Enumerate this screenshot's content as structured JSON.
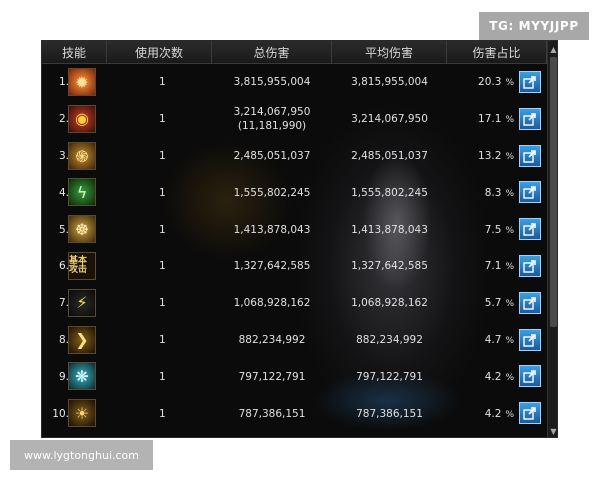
{
  "badge": "TG: MYYJJPP",
  "watermark": "www.lygtonghui.com",
  "colors": {
    "panel_bg": "#0b0b0b",
    "header_text": "#d8d8d8",
    "button_blue": "#2a7fc0"
  },
  "table": {
    "headers": [
      "技能",
      "使用次数",
      "总伤害",
      "平均伤害",
      "伤害占比"
    ],
    "rows": [
      {
        "rank": "1.",
        "icon": "flame-skill-icon",
        "uses": "1",
        "total": "3,815,955,004",
        "total_sub": "",
        "avg": "3,815,955,004",
        "pct": "20.3",
        "pct_sym": "%"
      },
      {
        "rank": "2.",
        "icon": "eye-skill-icon",
        "uses": "1",
        "total": "3,214,067,950",
        "total_sub": "(11,181,990)",
        "avg": "3,214,067,950",
        "pct": "17.1",
        "pct_sym": "%"
      },
      {
        "rank": "3.",
        "icon": "swirl-skill-icon",
        "uses": "1",
        "total": "2,485,051,037",
        "total_sub": "",
        "avg": "2,485,051,037",
        "pct": "13.2",
        "pct_sym": "%"
      },
      {
        "rank": "4.",
        "icon": "lightning-skill-icon",
        "uses": "1",
        "total": "1,555,802,245",
        "total_sub": "",
        "avg": "1,555,802,245",
        "pct": "8.3",
        "pct_sym": "%"
      },
      {
        "rank": "5.",
        "icon": "gear-skill-icon",
        "uses": "1",
        "total": "1,413,878,043",
        "total_sub": "",
        "avg": "1,413,878,043",
        "pct": "7.5",
        "pct_sym": "%"
      },
      {
        "rank": "6.",
        "icon": "basic-attack-icon",
        "icon_text": "基本攻击",
        "uses": "1",
        "total": "1,327,642,585",
        "total_sub": "",
        "avg": "1,327,642,585",
        "pct": "7.1",
        "pct_sym": "%"
      },
      {
        "rank": "7.",
        "icon": "bolt-skill-icon",
        "uses": "1",
        "total": "1,068,928,162",
        "total_sub": "",
        "avg": "1,068,928,162",
        "pct": "5.7",
        "pct_sym": "%"
      },
      {
        "rank": "8.",
        "icon": "arc-skill-icon",
        "uses": "1",
        "total": "882,234,992",
        "total_sub": "",
        "avg": "882,234,992",
        "pct": "4.7",
        "pct_sym": "%"
      },
      {
        "rank": "9.",
        "icon": "cluster-skill-icon",
        "uses": "1",
        "total": "797,122,791",
        "total_sub": "",
        "avg": "797,122,791",
        "pct": "4.2",
        "pct_sym": "%"
      },
      {
        "rank": "10.",
        "icon": "sun-skill-icon",
        "uses": "1",
        "total": "787,386,151",
        "total_sub": "",
        "avg": "787,386,151",
        "pct": "4.2",
        "pct_sym": "%"
      }
    ]
  }
}
